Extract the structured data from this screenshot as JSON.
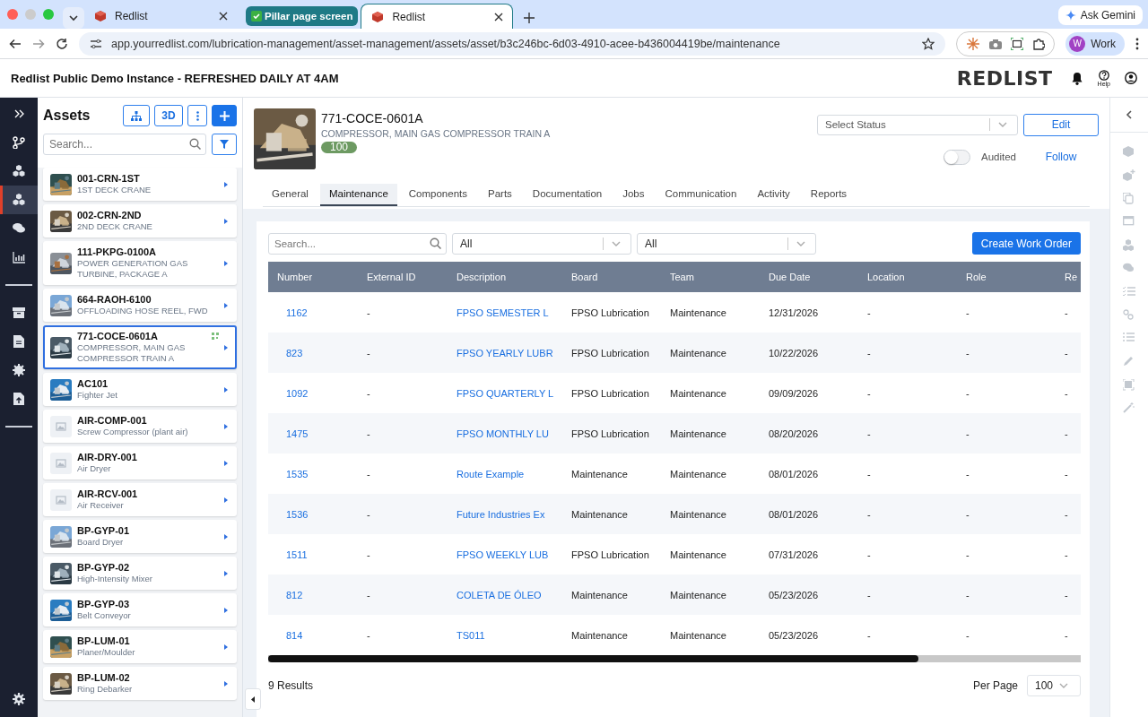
{
  "browser": {
    "tabs": [
      {
        "kind": "tab",
        "title": "Redlist",
        "selected": false
      },
      {
        "kind": "group",
        "title": "Pillar page screen",
        "selected": false
      },
      {
        "kind": "tab",
        "title": "Redlist",
        "selected": true
      }
    ],
    "url": "app.yourredlist.com/lubrication-management/asset-management/assets/asset/b3c246bc-6d03-4910-acee-b436004419be/maintenance",
    "ask_gemini": "Ask Gemini",
    "profile": {
      "initial": "W",
      "label": "Work"
    }
  },
  "header": {
    "title": "Redlist Public Demo Instance - REFRESHED DAILY AT 4AM",
    "logo": "REDLIST",
    "help": "Help"
  },
  "nav": {
    "groups": [
      {
        "items": [
          {
            "kind": "branch",
            "selected": false
          },
          {
            "kind": "cubes",
            "selected": false
          },
          {
            "kind": "cubes",
            "selected": true
          },
          {
            "kind": "chat",
            "selected": false
          },
          {
            "kind": "chart",
            "selected": false
          }
        ]
      },
      {
        "items": [
          {
            "kind": "archive",
            "selected": false
          },
          {
            "kind": "document",
            "selected": false
          },
          {
            "kind": "gear",
            "selected": false
          },
          {
            "kind": "upload",
            "selected": false
          }
        ]
      }
    ]
  },
  "assets": {
    "title": "Assets",
    "button_3d": "3D",
    "search": {
      "placeholder": "Search..."
    },
    "items": [
      {
        "code": "001-CRN-1ST",
        "description": "1ST DECK CRANE",
        "kind": "picture",
        "selected": false
      },
      {
        "code": "002-CRN-2ND",
        "description": "2ND DECK CRANE",
        "kind": "picture",
        "selected": false
      },
      {
        "code": "111-PKPG-0100A",
        "description": "POWER GENERATION GAS TURBINE, PACKAGE A",
        "kind": "picture",
        "selected": false
      },
      {
        "code": "664-RAOH-6100",
        "description": "OFFLOADING HOSE REEL, FWD",
        "kind": "picture",
        "selected": false
      },
      {
        "code": "771-COCE-0601A",
        "description": "COMPRESSOR, MAIN GAS COMPRESSOR TRAIN A",
        "kind": "picture",
        "selected": true
      },
      {
        "code": "AC101",
        "description": "Fighter Jet",
        "kind": "picture",
        "selected": false
      },
      {
        "code": "AIR-COMP-001",
        "description": "Screw Compressor (plant air)",
        "kind": "placeholder",
        "selected": false
      },
      {
        "code": "AIR-DRY-001",
        "description": "Air Dryer",
        "kind": "placeholder",
        "selected": false
      },
      {
        "code": "AIR-RCV-001",
        "description": "Air Receiver",
        "kind": "placeholder",
        "selected": false
      },
      {
        "code": "BP-GYP-01",
        "description": "Board Dryer",
        "kind": "picture",
        "selected": false
      },
      {
        "code": "BP-GYP-02",
        "description": "High-Intensity Mixer",
        "kind": "picture",
        "selected": false
      },
      {
        "code": "BP-GYP-03",
        "description": "Belt Conveyor",
        "kind": "picture",
        "selected": false
      },
      {
        "code": "BP-LUM-01",
        "description": "Planer/Moulder",
        "kind": "picture",
        "selected": false
      },
      {
        "code": "BP-LUM-02",
        "description": "Ring Debarker",
        "kind": "picture",
        "selected": false
      }
    ]
  },
  "asset": {
    "code": "771-COCE-0601A",
    "description": "COMPRESSOR, MAIN GAS COMPRESSOR TRAIN A",
    "score": "100",
    "status": {
      "placeholder": "Select Status"
    },
    "edit": "Edit",
    "audited": {
      "label": "Audited",
      "on": false
    },
    "follow": "Follow"
  },
  "tabs": [
    {
      "label": "General",
      "selected": false
    },
    {
      "label": "Maintenance",
      "selected": true
    },
    {
      "label": "Components",
      "selected": false
    },
    {
      "label": "Parts",
      "selected": false
    },
    {
      "label": "Documentation",
      "selected": false
    },
    {
      "label": "Jobs",
      "selected": false
    },
    {
      "label": "Communication",
      "selected": false
    },
    {
      "label": "Activity",
      "selected": false
    },
    {
      "label": "Reports",
      "selected": false
    }
  ],
  "filters": {
    "search": {
      "placeholder": "Search..."
    },
    "selects": [
      "All",
      "All"
    ],
    "create": "Create Work Order"
  },
  "table": {
    "columns": [
      "Number",
      "External ID",
      "Description",
      "Board",
      "Team",
      "Due Date",
      "Location",
      "Role",
      "Re"
    ],
    "rows": [
      [
        "1162",
        "-",
        "FPSO SEMESTER L",
        "FPSO Lubrication",
        "Maintenance",
        "12/31/2026",
        "-",
        "-",
        "-"
      ],
      [
        "823",
        "-",
        "FPSO YEARLY LUBR",
        "FPSO Lubrication",
        "Maintenance",
        "10/22/2026",
        "-",
        "-",
        "-"
      ],
      [
        "1092",
        "-",
        "FPSO QUARTERLY L",
        "FPSO Lubrication",
        "Maintenance",
        "09/09/2026",
        "-",
        "-",
        "-"
      ],
      [
        "1475",
        "-",
        "FPSO MONTHLY LU",
        "FPSO Lubrication",
        "Maintenance",
        "08/20/2026",
        "-",
        "-",
        "-"
      ],
      [
        "1535",
        "-",
        "Route Example",
        "Maintenance",
        "Maintenance",
        "08/01/2026",
        "-",
        "-",
        "-"
      ],
      [
        "1536",
        "-",
        "Future Industries Ex",
        "Maintenance",
        "Maintenance",
        "08/01/2026",
        "-",
        "-",
        "-"
      ],
      [
        "1511",
        "-",
        "FPSO WEEKLY LUB",
        "FPSO Lubrication",
        "Maintenance",
        "07/31/2026",
        "-",
        "-",
        "-"
      ],
      [
        "812",
        "-",
        "COLETA DE ÓLEO",
        "Maintenance",
        "Maintenance",
        "05/23/2026",
        "-",
        "-",
        "-"
      ],
      [
        "814",
        "-",
        "TS011",
        "Maintenance",
        "Maintenance",
        "05/23/2026",
        "-",
        "-",
        "-"
      ]
    ]
  },
  "footer": {
    "results": "9 Results",
    "per_page_label": "Per Page",
    "per_page": "100"
  }
}
